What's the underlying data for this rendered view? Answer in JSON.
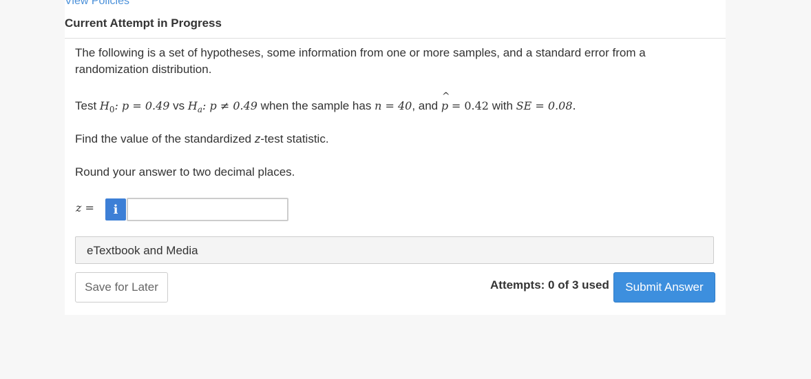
{
  "header": {
    "view_policies": "View Policies",
    "attempt_title": "Current Attempt in Progress"
  },
  "question": {
    "intro": "The following is a set of hypotheses, some information from one or more samples, and a standard error from a randomization distribution.",
    "test_word": "Test",
    "h0_label": "H",
    "h0_sub": "0",
    "h0_expr": ": p = 0.49",
    "vs_word": "vs",
    "ha_label": "H",
    "ha_sub": "a",
    "ha_expr": ": p ≠ 0.49",
    "when_text": "when the sample has",
    "n_expr": "n = 40",
    "and_text": ", and",
    "p_letter": "p",
    "p_hat_mark": "^",
    "phat_expr": "= 0.42",
    "with_text": "with",
    "se_expr": "SE = 0.08",
    "period": ".",
    "find_prefix": "Find the value of the standardized",
    "find_z": "z",
    "find_suffix": "-test statistic.",
    "round_text": "Round your answer to two decimal places."
  },
  "answer": {
    "z_label": "z =",
    "info_icon": "i",
    "value": "",
    "placeholder": ""
  },
  "etextbook": {
    "label": "eTextbook and Media"
  },
  "footer": {
    "save_label": "Save for Later",
    "attempts_text": "Attempts: 0 of 3 used",
    "submit_label": "Submit Answer"
  }
}
